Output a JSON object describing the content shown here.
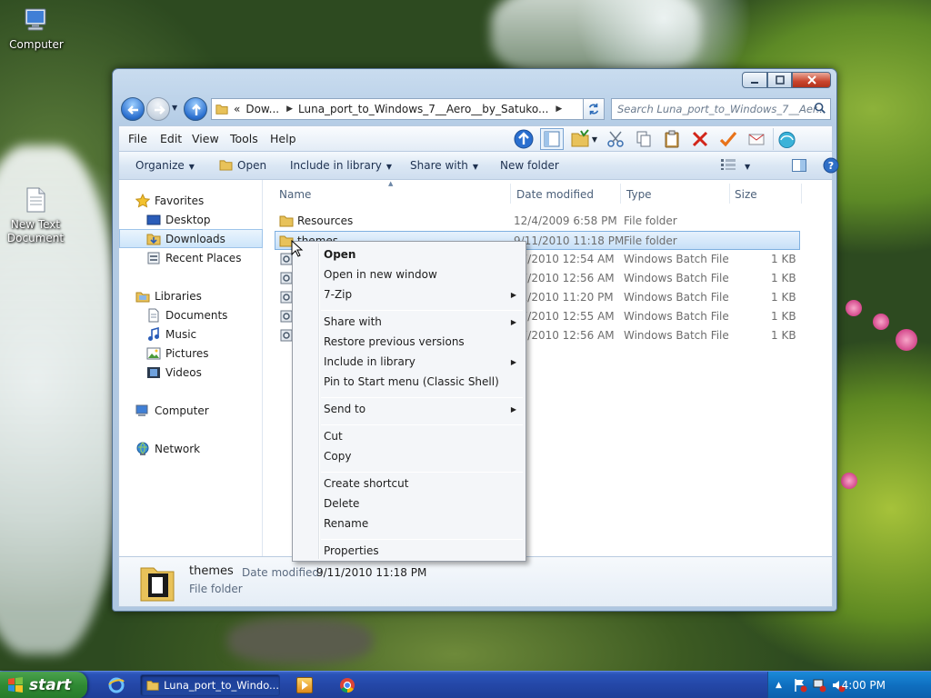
{
  "desktop": {
    "icons": [
      {
        "label": "Computer"
      },
      {
        "label": "New Text\nDocument"
      }
    ]
  },
  "window": {
    "address": {
      "segments": [
        "«",
        "Dow...",
        "Luna_port_to_Windows_7__Aero__by_Satuko..."
      ],
      "search_placeholder": "Search Luna_port_to_Windows_7__Aer..."
    },
    "menu": [
      "File",
      "Edit",
      "View",
      "Tools",
      "Help"
    ],
    "commands": {
      "organize": "Organize",
      "open": "Open",
      "include": "Include in library",
      "share": "Share with",
      "new_folder": "New folder"
    },
    "nav": {
      "favorites": "Favorites",
      "desktop": "Desktop",
      "downloads": "Downloads",
      "recent": "Recent Places",
      "libraries": "Libraries",
      "documents": "Documents",
      "music": "Music",
      "pictures": "Pictures",
      "videos": "Videos",
      "computer": "Computer",
      "network": "Network"
    },
    "columns": {
      "name": "Name",
      "date": "Date modified",
      "type": "Type",
      "size": "Size"
    },
    "files": [
      {
        "name": "Resources",
        "date": "12/4/2009 6:58 PM",
        "type": "File folder",
        "size": "",
        "kind": "folder"
      },
      {
        "name": "themes",
        "date": "9/11/2010 11:18 PM",
        "type": "File folder",
        "size": "",
        "kind": "folder"
      },
      {
        "name": "",
        "date": "27/2010 12:54 AM",
        "type": "Windows Batch File",
        "size": "1 KB",
        "kind": "batch"
      },
      {
        "name": "",
        "date": "27/2010 12:56 AM",
        "type": "Windows Batch File",
        "size": "1 KB",
        "kind": "batch"
      },
      {
        "name": "",
        "date": "11/2010 11:20 PM",
        "type": "Windows Batch File",
        "size": "1 KB",
        "kind": "batch"
      },
      {
        "name": "",
        "date": "27/2010 12:55 AM",
        "type": "Windows Batch File",
        "size": "1 KB",
        "kind": "batch"
      },
      {
        "name": "",
        "date": "27/2010 12:56 AM",
        "type": "Windows Batch File",
        "size": "1 KB",
        "kind": "batch"
      }
    ],
    "details": {
      "name": "themes",
      "date_label": "Date modified:",
      "date_value": "9/11/2010 11:18 PM",
      "type": "File folder"
    }
  },
  "context_menu": {
    "items": [
      {
        "label": "Open",
        "bold": true
      },
      {
        "label": "Open in new window"
      },
      {
        "label": "7-Zip",
        "submenu": true
      },
      {
        "label": "Share with",
        "submenu": true
      },
      {
        "label": "Restore previous versions"
      },
      {
        "label": "Include in library",
        "submenu": true
      },
      {
        "label": "Pin to Start menu (Classic Shell)"
      },
      {
        "label": "Send to",
        "submenu": true
      },
      {
        "label": "Cut"
      },
      {
        "label": "Copy"
      },
      {
        "label": "Create shortcut"
      },
      {
        "label": "Delete"
      },
      {
        "label": "Rename"
      },
      {
        "label": "Properties"
      }
    ]
  },
  "taskbar": {
    "start_label": "start",
    "task_label": "Luna_port_to_Windo...",
    "clock": "4:00 PM"
  },
  "colors": {
    "selection": "#cde5fa",
    "taskbar": "#2447a7",
    "start": "#2f8a33"
  }
}
